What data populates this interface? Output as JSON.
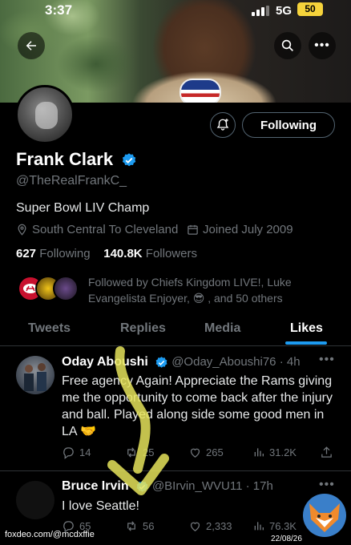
{
  "status_bar": {
    "time": "3:37",
    "network": "5G",
    "battery": "50"
  },
  "profile": {
    "name": "Frank Clark",
    "handle": "@TheRealFrankC_",
    "bio": "Super Bowl LIV Champ",
    "location": "South Central To Cleveland",
    "joined": "Joined July 2009",
    "following_count": "627",
    "following_label": "Following",
    "followers_count": "140.8K",
    "followers_label": "Followers",
    "followed_by": "Followed by Chiefs Kingdom LIVE!, Luke Evangelista Enjoyer, 😎 , and 50 others",
    "follow_button": "Following"
  },
  "tabs": [
    "Tweets",
    "Replies",
    "Media",
    "Likes"
  ],
  "active_tab": "Likes",
  "tweets": [
    {
      "name": "Oday Aboushi",
      "handle": "@Oday_Aboushi76",
      "time": "· 4h",
      "text": "Free agency Again! Appreciate the Rams giving me the opportunity to come back after the injury and ball. Played along side some good men in LA 🤝",
      "replies": "14",
      "retweets": "25",
      "likes": "265",
      "views": "31.2K"
    },
    {
      "name": "Bruce Irvin",
      "handle": "@BIrvin_WVU11",
      "time": "· 17h",
      "text": "I love Seattle!",
      "replies": "65",
      "retweets": "56",
      "likes": "2,333",
      "views": "76.3K"
    }
  ],
  "watermark": "foxdeo.com/@mcdxffie",
  "date_stamp": "22/08/26",
  "colors": {
    "accent": "#1d9bf0",
    "background": "#000000",
    "secondary_text": "#71767b",
    "arrow": "#e5e35a"
  }
}
